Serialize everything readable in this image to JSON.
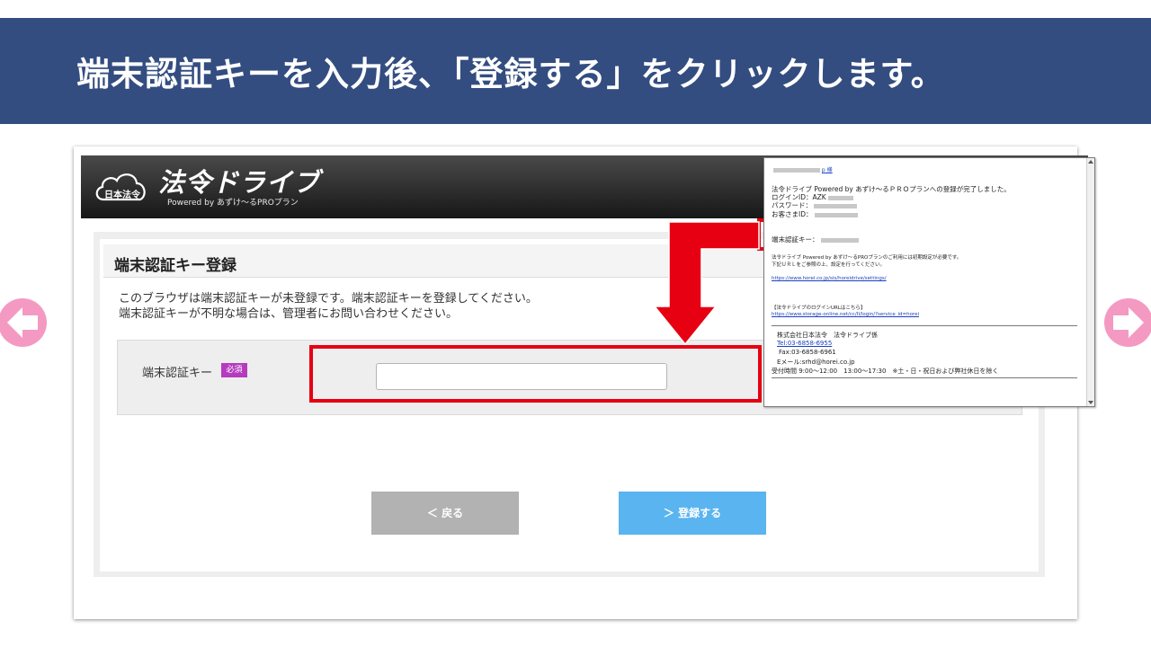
{
  "banner": {
    "instruction": "端末認証キーを入力後、「登録する」をクリックします。"
  },
  "app": {
    "logo_text": "法令ドライブ",
    "logo_sub": "Powered by あずけ〜るPROプラン",
    "logo_mark": "日本法令"
  },
  "page": {
    "title": "端末認証キー登録",
    "desc_line1": "このブラウザは端末認証キーが未登録です。端末認証キーを登録してください。",
    "desc_line2": "端末認証キーが不明な場合は、管理者にお問い合わせください。"
  },
  "form": {
    "label": "端末認証キー",
    "required": "必須",
    "value": ""
  },
  "buttons": {
    "back": "＜  戻る",
    "register": "＞  登録する"
  },
  "mail": {
    "to": "p 様",
    "line1": "法令ドライブ Powered by あずけ～るＰＲＯプランへの登録が完了しました。",
    "login_id": "ログインID：AZK",
    "password": "パスワード：",
    "customer_id": "お客さまID：",
    "auth_key": "端末認証キー：",
    "note1": "法令ドライブ Powered by あずけ～るPROプランのご利用には初期設定が必要です。",
    "note2": "下記ＵＲＬをご参照の上、設定を行ってください。",
    "url1": "https://www.horei.co.jp/sis/horeidrive/settings/",
    "login_heading": "【法令ドライブのログインURLはこちら】",
    "url2": "https://www.storage-online.net/cc/II/login/?service_id=horei",
    "company": "株式会社日本法令　法令ドライブ係",
    "tel": "Tel:03-6858-6955",
    "fax": "Fax:03-6858-6961",
    "email": "Eメール:srhd@horei.co.jp",
    "hours": "受付時間 9:00～12:00　13:00～17:30　※土・日・祝日および弊社休日を除く"
  },
  "colors": {
    "banner": "#334d80",
    "highlight": "#e60012",
    "nav_arrow": "#f49ac2",
    "register_button": "#5ab4ef",
    "back_button": "#b2b2b2",
    "required_badge": "#b53cbe"
  },
  "icons": {
    "prev": "arrow-left-icon",
    "next": "arrow-right-icon",
    "cloud": "cloud-logo-icon",
    "callout": "arrow-down-callout-icon"
  }
}
